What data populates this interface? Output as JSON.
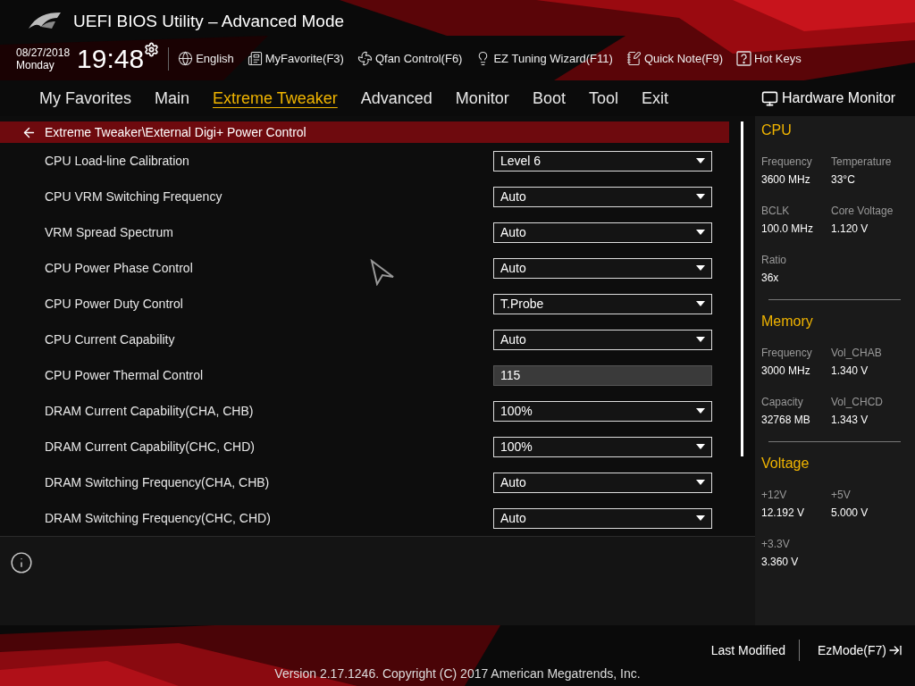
{
  "header": {
    "title": "UEFI BIOS Utility – Advanced Mode",
    "date": "08/27/2018",
    "day": "Monday",
    "time": "19:48"
  },
  "toolbar": [
    {
      "kind": "language",
      "label": "English"
    },
    {
      "kind": "favorite",
      "label": "MyFavorite(F3)"
    },
    {
      "kind": "fan",
      "label": "Qfan Control(F6)"
    },
    {
      "kind": "wizard",
      "label": "EZ Tuning Wizard(F11)"
    },
    {
      "kind": "note",
      "label": "Quick Note(F9)"
    },
    {
      "kind": "hotkeys",
      "label": "Hot Keys"
    }
  ],
  "tabs": [
    {
      "label": "My Favorites",
      "selected": false
    },
    {
      "label": "Main",
      "selected": false
    },
    {
      "label": "Extreme Tweaker",
      "selected": true
    },
    {
      "label": "Advanced",
      "selected": false
    },
    {
      "label": "Monitor",
      "selected": false
    },
    {
      "label": "Boot",
      "selected": false
    },
    {
      "label": "Tool",
      "selected": false
    },
    {
      "label": "Exit",
      "selected": false
    }
  ],
  "breadcrumb": "Extreme Tweaker\\External Digi+ Power Control",
  "settings": [
    {
      "label": "CPU Load-line Calibration",
      "kind": "select",
      "value": "Level 6"
    },
    {
      "label": "CPU VRM Switching Frequency",
      "kind": "select",
      "value": "Auto"
    },
    {
      "label": "VRM Spread Spectrum",
      "kind": "select",
      "value": "Auto"
    },
    {
      "label": "CPU Power Phase Control",
      "kind": "select",
      "value": "Auto"
    },
    {
      "label": "CPU Power Duty Control",
      "kind": "select",
      "value": "T.Probe"
    },
    {
      "label": "CPU Current Capability",
      "kind": "select",
      "value": "Auto"
    },
    {
      "label": "CPU Power Thermal Control",
      "kind": "input",
      "value": "115"
    },
    {
      "label": "DRAM Current Capability(CHA, CHB)",
      "kind": "select",
      "value": "100%"
    },
    {
      "label": "DRAM Current Capability(CHC, CHD)",
      "kind": "select",
      "value": "100%"
    },
    {
      "label": "DRAM Switching Frequency(CHA, CHB)",
      "kind": "select",
      "value": "Auto"
    },
    {
      "label": "DRAM Switching Frequency(CHC, CHD)",
      "kind": "select",
      "value": "Auto"
    }
  ],
  "monitor": {
    "title": "Hardware Monitor",
    "sections": [
      {
        "title": "CPU",
        "items": [
          {
            "label": "Frequency",
            "value": "3600 MHz"
          },
          {
            "label": "Temperature",
            "value": "33°C"
          },
          {
            "label": "BCLK",
            "value": "100.0 MHz"
          },
          {
            "label": "Core Voltage",
            "value": "1.120 V"
          },
          {
            "label": "Ratio",
            "value": "36x"
          }
        ]
      },
      {
        "title": "Memory",
        "items": [
          {
            "label": "Frequency",
            "value": "3000 MHz"
          },
          {
            "label": "Vol_CHAB",
            "value": "1.340 V"
          },
          {
            "label": "Capacity",
            "value": "32768 MB"
          },
          {
            "label": "Vol_CHCD",
            "value": "1.343 V"
          }
        ]
      },
      {
        "title": "Voltage",
        "items": [
          {
            "label": "+12V",
            "value": "12.192 V"
          },
          {
            "label": "+5V",
            "value": "5.000 V"
          },
          {
            "label": "+3.3V",
            "value": "3.360 V"
          }
        ]
      }
    ]
  },
  "footer": {
    "last_modified": "Last Modified",
    "ez_mode": "EzMode(F7)",
    "version": "Version 2.17.1246. Copyright (C) 2017 American Megatrends, Inc."
  }
}
